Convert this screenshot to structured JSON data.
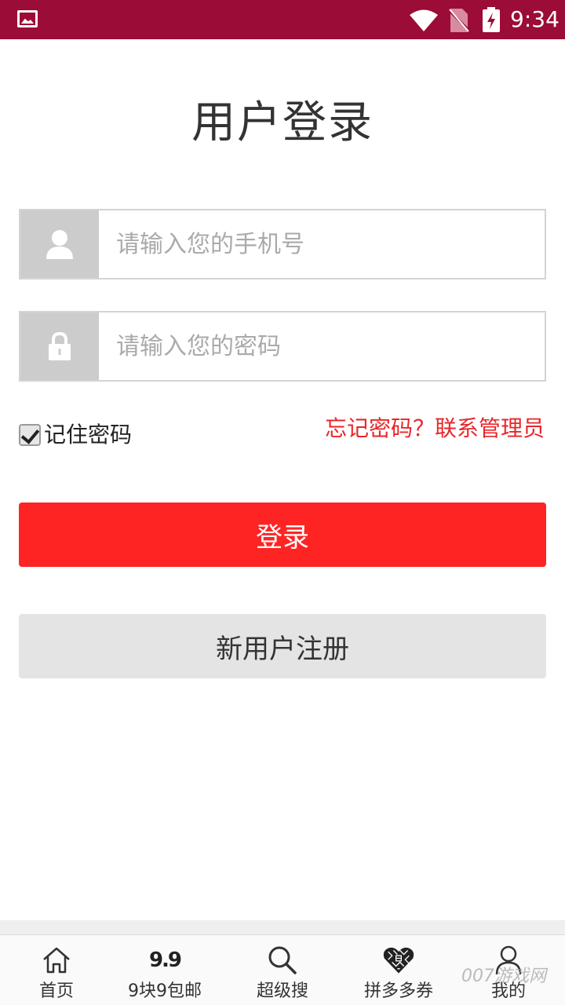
{
  "status_bar": {
    "time": "9:34"
  },
  "page": {
    "title": "用户登录"
  },
  "form": {
    "phone_placeholder": "请输入您的手机号",
    "password_placeholder": "请输入您的密码",
    "remember_label": "记住密码",
    "remember_checked": true,
    "forgot_link": "忘记密码？联系管理员",
    "login_button": "登录",
    "register_button": "新用户注册"
  },
  "colors": {
    "status_bar": "#9b0c36",
    "login_button": "#ff2424",
    "forgot_link": "#e8262a",
    "register_button": "#e4e4e4"
  },
  "tabs": [
    {
      "label": "首页",
      "icon": "home-icon"
    },
    {
      "label": "9块9包邮",
      "icon": "nine-nine-icon",
      "icon_text": "9.9"
    },
    {
      "label": "超级搜",
      "icon": "search-icon"
    },
    {
      "label": "拼多多券",
      "icon": "pinduoduo-icon"
    },
    {
      "label": "我的",
      "icon": "user-icon"
    }
  ],
  "watermark": "007游戏网"
}
